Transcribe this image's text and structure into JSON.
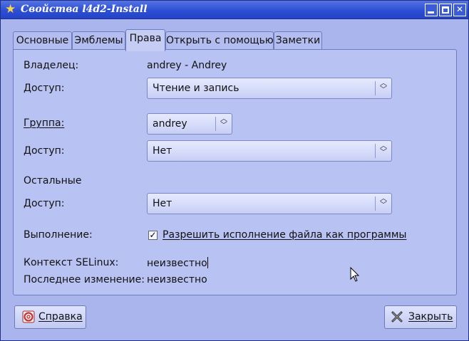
{
  "window": {
    "title": "Свойства l4d2-Install"
  },
  "tabs": [
    {
      "label": "Основные"
    },
    {
      "label": "Эмблемы"
    },
    {
      "label": "Права"
    },
    {
      "label": "Открыть с помощью"
    },
    {
      "label": "Заметки"
    }
  ],
  "active_tab": "Права",
  "owner": {
    "label": "Владелец:",
    "value": "andrey - Andrey",
    "access_label": "Доступ:",
    "access_value": "Чтение и запись"
  },
  "group": {
    "label": "Группа:",
    "value": "andrey",
    "access_label": "Доступ:",
    "access_value": "Нет"
  },
  "others": {
    "label": "Остальные",
    "access_label": "Доступ:",
    "access_value": "Нет"
  },
  "execute": {
    "label": "Выполнение:",
    "checkbox_label": "Разрешить исполнение файла как программы",
    "checked": true
  },
  "selinux": {
    "label": "Контекст SELinux:",
    "value": "неизвестно"
  },
  "modified": {
    "label": "Последнее изменение:",
    "value": "неизвестно"
  },
  "buttons": {
    "help": "Справка",
    "close": "Закрыть"
  }
}
